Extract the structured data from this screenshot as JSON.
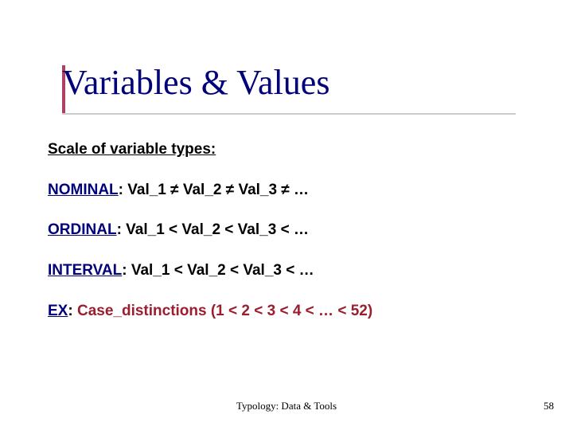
{
  "title": "Variables & Values",
  "subtitle": "Scale of variable types:",
  "rows": {
    "nominal_label": "NOMINAL",
    "nominal_rest": ": Val_1 ≠ Val_2 ≠ Val_3 ≠ …",
    "ordinal_label": "ORDINAL",
    "ordinal_rest": ": Val_1 < Val_2 < Val_3 < …",
    "interval_label": "INTERVAL",
    "interval_rest": ": Val_1 < Val_2 < Val_3 < …",
    "ex_label": "EX",
    "ex_colon": ": ",
    "ex_rest": "Case_distinctions (1 < 2 < 3 < 4 < … < 52)"
  },
  "footer": {
    "center": "Typology: Data & Tools",
    "page": "58"
  }
}
